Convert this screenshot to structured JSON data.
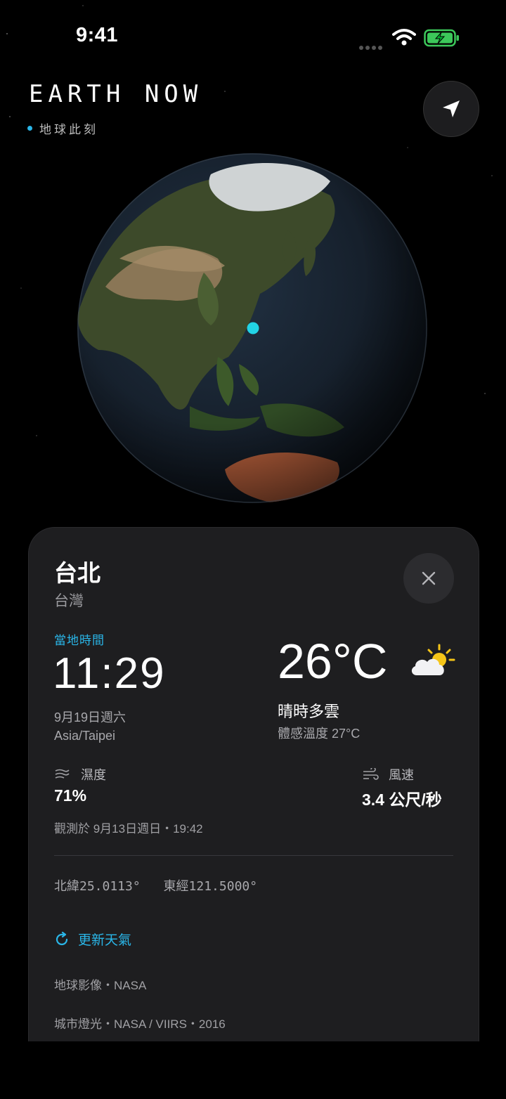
{
  "status_bar": {
    "time": "9:41"
  },
  "header": {
    "brand": "EARTH NOW",
    "subtitle": "地球此刻"
  },
  "card": {
    "city": "台北",
    "country": "台灣",
    "local_time_label": "當地時間",
    "local_time": "11:29",
    "date": "9月19日週六",
    "timezone": "Asia/Taipei",
    "temperature": "26°C",
    "condition": "晴時多雲",
    "feels_like": "體感溫度 27°C",
    "humidity_label": "濕度",
    "humidity_value": "71%",
    "wind_label": "風速",
    "wind_value": "3.4 公尺/秒",
    "observed": "觀測於 9月13日週日・19:42",
    "latitude": "北緯25.0113°",
    "longitude": "東經121.5000°",
    "refresh_label": "更新天氣",
    "credit_image": "地球影像・NASA",
    "credit_lights": "城市燈光・NASA / VIIRS・2016"
  },
  "colors": {
    "accent": "#2ab6e8",
    "card_bg": "#1e1e20",
    "marker": "#22d3e6"
  },
  "icons": [
    "wifi-icon",
    "battery-charging-icon",
    "location-arrow-icon",
    "close-icon",
    "partly-sunny-icon",
    "humidity-icon",
    "wind-icon",
    "refresh-icon"
  ]
}
